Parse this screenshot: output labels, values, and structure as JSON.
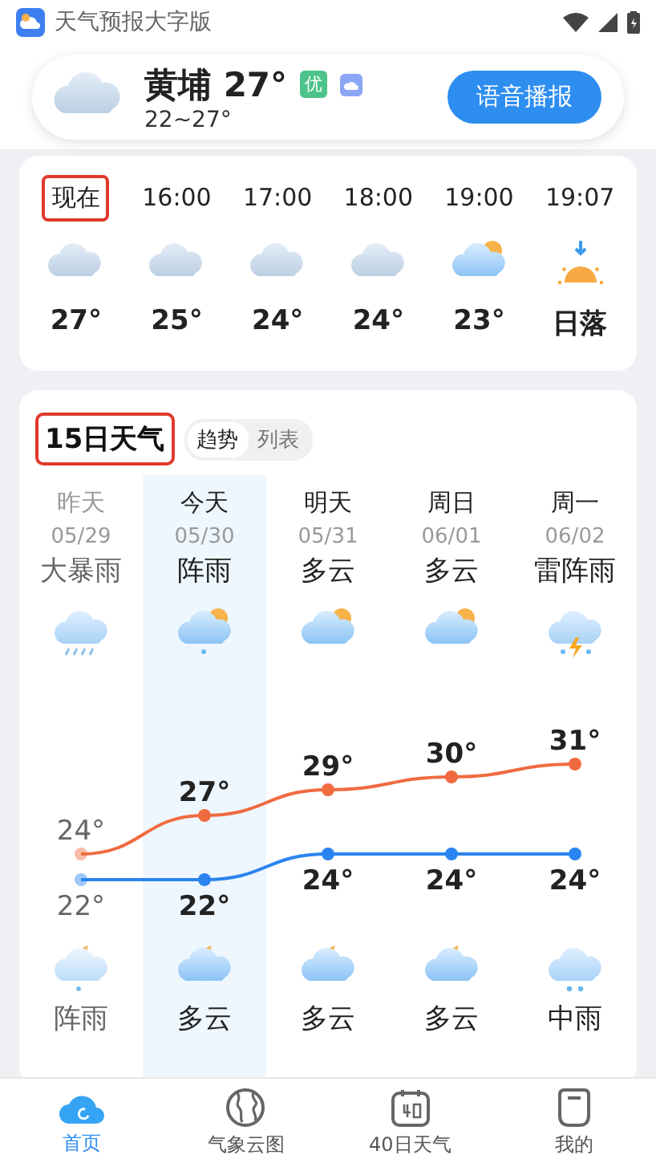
{
  "status_bar": {
    "app_title": "天气预报大字版"
  },
  "header": {
    "location": "黄埔",
    "temperature": "27°",
    "aqi": "优",
    "range": "22~27°",
    "voice_button": "语音播报"
  },
  "hourly": [
    {
      "time": "现在",
      "kind": "cloudy",
      "temp": "27°",
      "highlighted": true
    },
    {
      "time": "16:00",
      "kind": "cloudy",
      "temp": "25°",
      "highlighted": false
    },
    {
      "time": "17:00",
      "kind": "cloudy",
      "temp": "24°",
      "highlighted": false
    },
    {
      "time": "18:00",
      "kind": "cloudy",
      "temp": "24°",
      "highlighted": false
    },
    {
      "time": "19:00",
      "kind": "partly_cloudy",
      "temp": "23°",
      "highlighted": false
    },
    {
      "time": "19:07",
      "kind": "sunset",
      "temp": "日落",
      "highlighted": false
    }
  ],
  "forecast": {
    "title": "15日天气",
    "title_highlighted": true,
    "view_tabs": [
      {
        "label": "趋势",
        "selected": true
      },
      {
        "label": "列表",
        "selected": false
      }
    ],
    "days": [
      {
        "day": "昨天",
        "date": "05/29",
        "condition": "大暴雨",
        "kind": "heavy_rain",
        "night": {
          "kind": "night_shower",
          "condition": "阵雨"
        },
        "past": true,
        "selected": false
      },
      {
        "day": "今天",
        "date": "05/30",
        "condition": "阵雨",
        "kind": "shower",
        "night": {
          "kind": "night_cloudy",
          "condition": "多云"
        },
        "past": false,
        "selected": true
      },
      {
        "day": "明天",
        "date": "05/31",
        "condition": "多云",
        "kind": "partly_cloudy",
        "night": {
          "kind": "night_cloudy",
          "condition": "多云"
        },
        "past": false,
        "selected": false
      },
      {
        "day": "周日",
        "date": "06/01",
        "condition": "多云",
        "kind": "partly_cloudy",
        "night": {
          "kind": "night_cloudy",
          "condition": "多云"
        },
        "past": false,
        "selected": false
      },
      {
        "day": "周一",
        "date": "06/02",
        "condition": "雷阵雨",
        "kind": "thunder_shower",
        "night": {
          "kind": "moderate_rain",
          "condition": "中雨"
        },
        "past": false,
        "selected": false
      }
    ],
    "chart_data": {
      "type": "line",
      "series": [
        {
          "color": "#f06a40",
          "marker": true,
          "values": [
            24,
            27,
            29,
            30,
            31
          ],
          "value_labels": [
            "24°",
            "27°",
            "29°",
            "30°",
            "31°"
          ]
        },
        {
          "color": "#2a84f0",
          "marker": true,
          "values": [
            22,
            22,
            24,
            24,
            24
          ],
          "value_labels": [
            "22°",
            "22°",
            "24°",
            "24°",
            "24°"
          ]
        }
      ]
    }
  },
  "nav": [
    {
      "label": "首页",
      "kind": "cloud",
      "selected": true
    },
    {
      "label": "气象云图",
      "kind": "globe",
      "selected": false
    },
    {
      "label": "40日天气",
      "kind": "calendar",
      "selected": false
    },
    {
      "label": "我的",
      "kind": "cup",
      "selected": false
    }
  ]
}
